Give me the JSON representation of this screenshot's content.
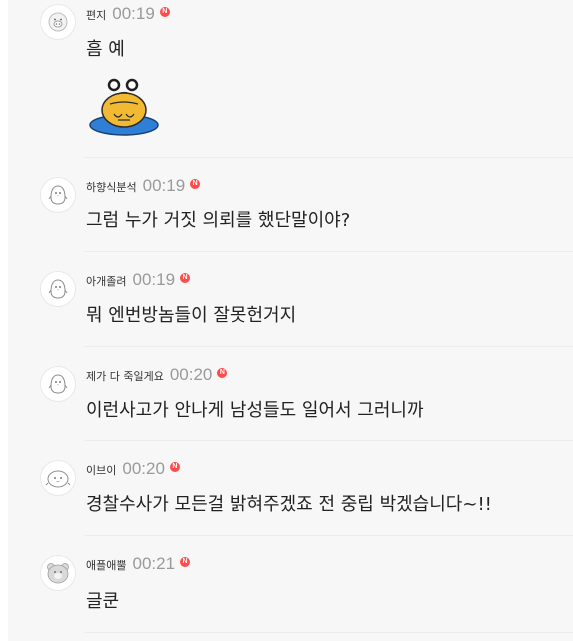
{
  "comments": [
    {
      "nickname": "편지",
      "time": "00:19",
      "badge": "N",
      "text": "흠 예",
      "avatar": "pig-face-avatar",
      "sticker": "crying-pumpkin-emoticon"
    },
    {
      "nickname": "하향식분석",
      "time": "00:19",
      "badge": "N",
      "text": "그럼 누가 거짓 의뢰를 했단말이야?",
      "avatar": "penguin-avatar"
    },
    {
      "nickname": "아개졸려",
      "time": "00:19",
      "badge": "N",
      "text": "뭐 엔번방놈들이 잘못헌거지",
      "avatar": "penguin-avatar"
    },
    {
      "nickname": "제가 다 죽일게요",
      "time": "00:20",
      "badge": "N",
      "text": "이런사고가 안나게 남성들도 일어서 그러니까",
      "avatar": "penguin-avatar"
    },
    {
      "nickname": "이브이",
      "time": "00:20",
      "badge": "N",
      "text": "경찰수사가 모든걸 밝혀주겠죠 전 중립 박겠습니다~!!",
      "avatar": "blob-avatar"
    },
    {
      "nickname": "애플애뿔",
      "time": "00:21",
      "badge": "N",
      "text": "글쿤",
      "avatar": "bear-avatar"
    }
  ]
}
